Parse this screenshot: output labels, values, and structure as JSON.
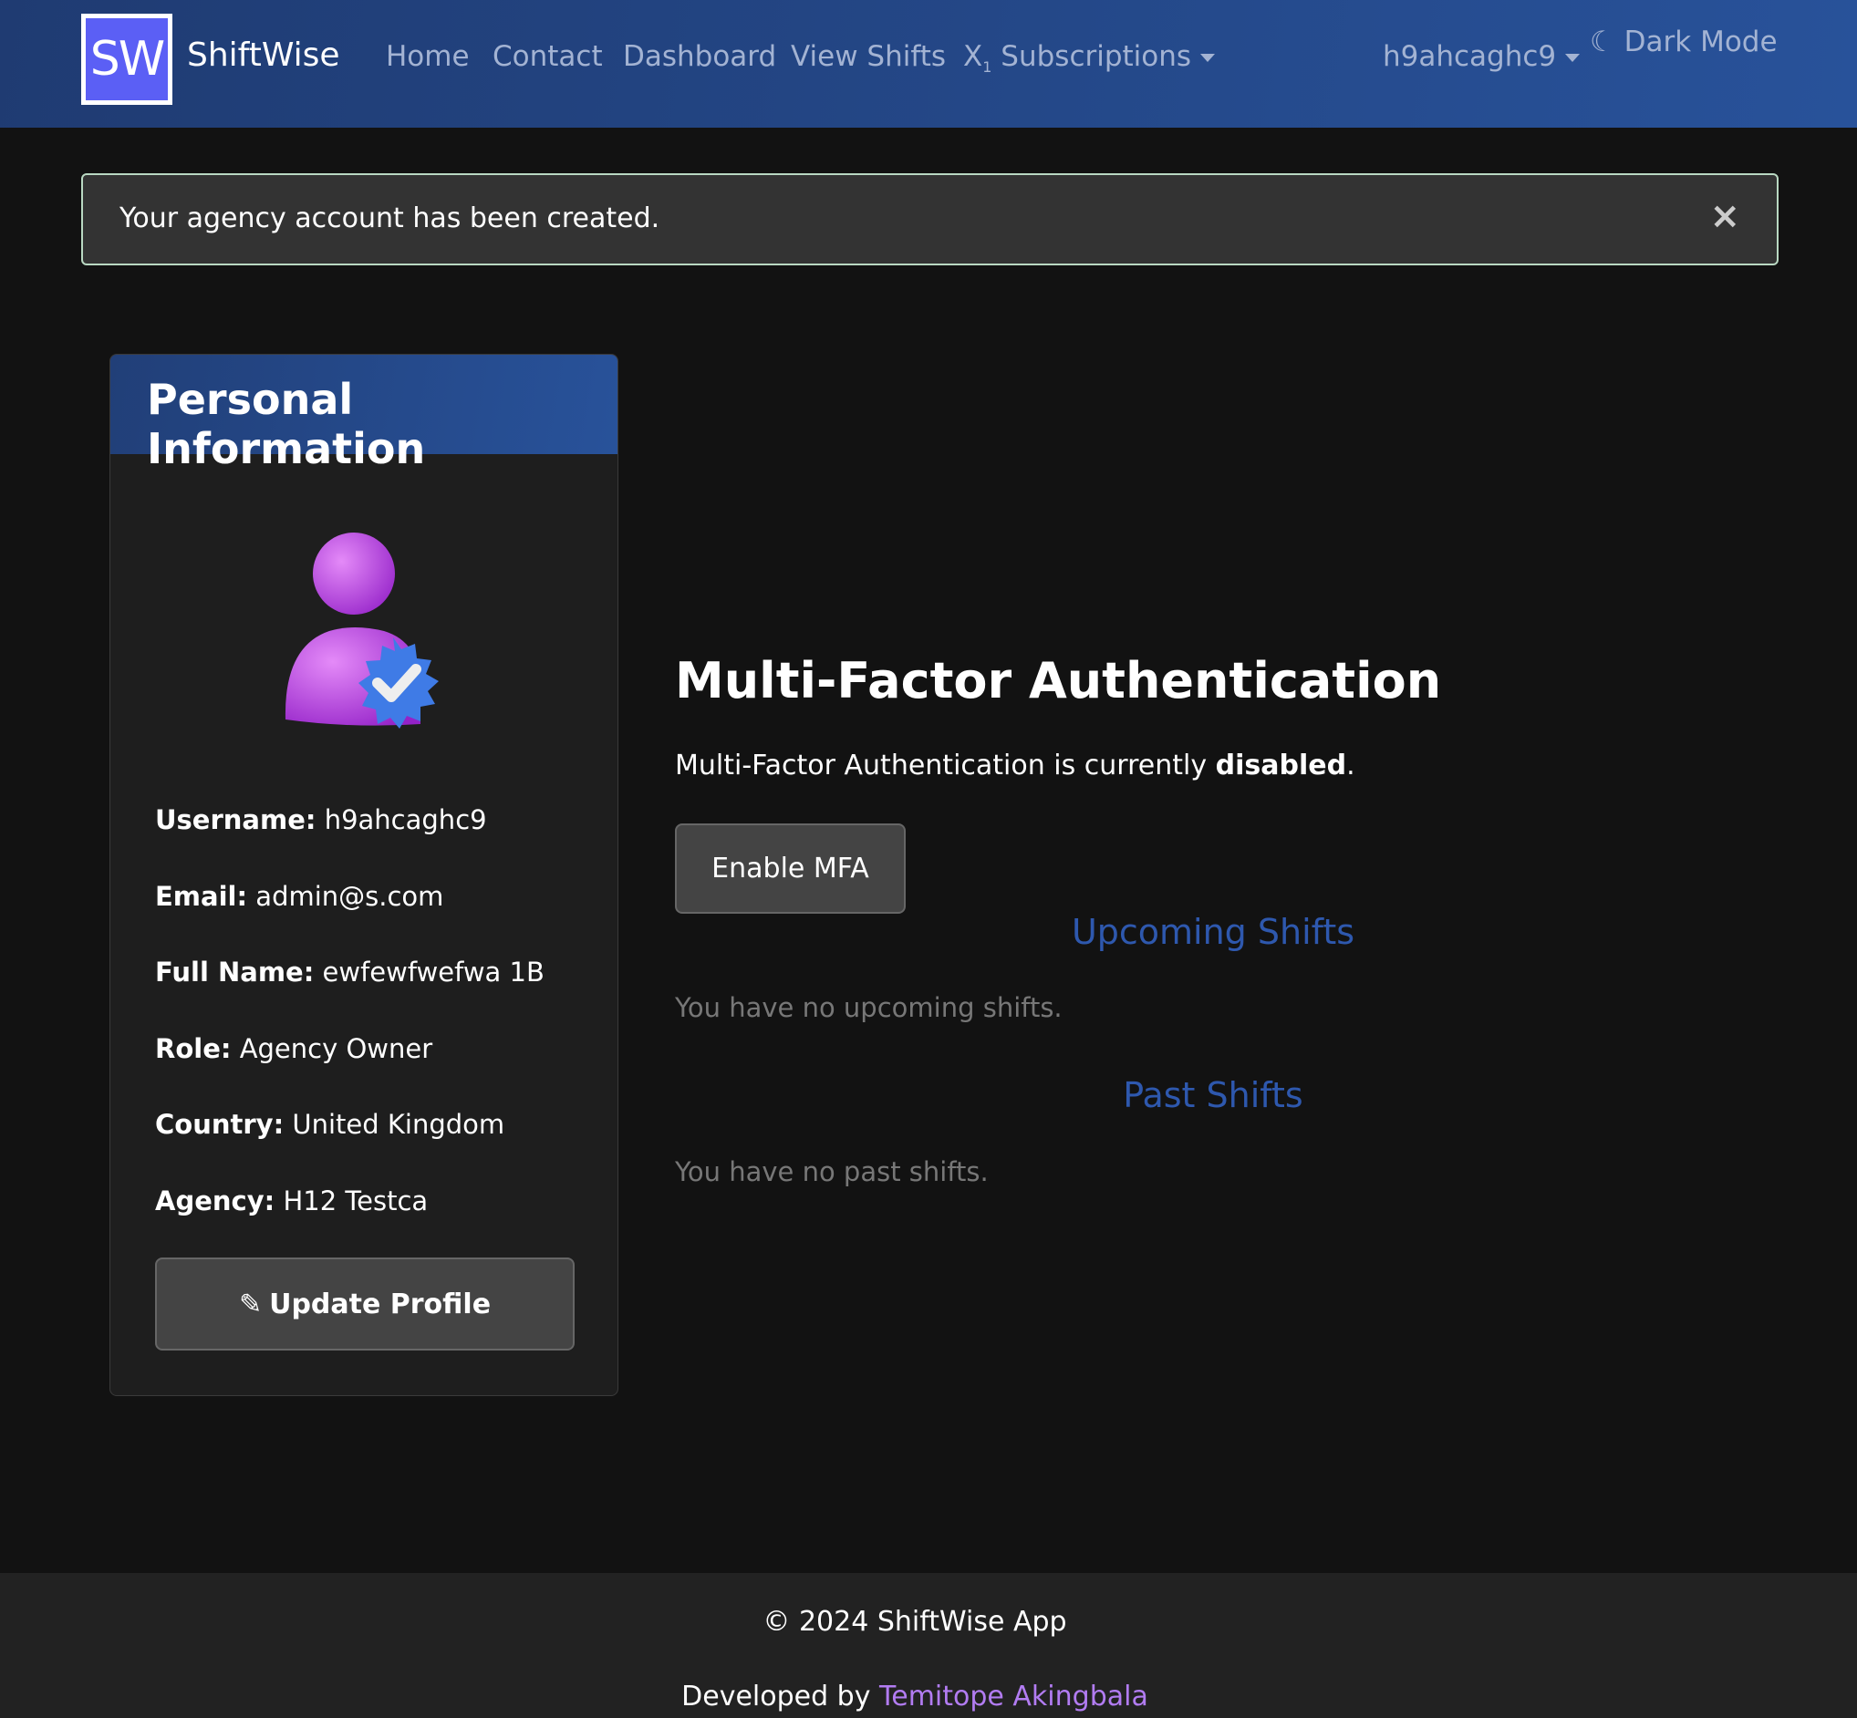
{
  "header": {
    "logo": "SW",
    "brand": "ShiftWise",
    "nav": [
      "Home",
      "Contact",
      "Dashboard",
      "View Shifts"
    ],
    "subscriptions": "Subscriptions",
    "subscriptions_icon": "subscript-icon",
    "user": "h9ahcaghc9",
    "dark_mode": "Dark Mode"
  },
  "alert": {
    "message": "Your agency account has been created.",
    "close": "×"
  },
  "profile": {
    "title": "Personal Information",
    "fields": [
      {
        "label": "Username:",
        "value": "h9ahcaghc9"
      },
      {
        "label": "Email:",
        "value": "admin@s.com"
      },
      {
        "label": "Full Name:",
        "value": "ewfewfwefwa 1B"
      },
      {
        "label": "Role:",
        "value": "Agency Owner"
      },
      {
        "label": "Country:",
        "value": "United Kingdom"
      },
      {
        "label": "Agency:",
        "value": "H12 Testca"
      }
    ],
    "update_button": "Update Profile"
  },
  "mfa": {
    "title": "Multi-Factor Authentication",
    "status_prefix": "Multi-Factor Authentication is currently ",
    "status": "disabled",
    "status_suffix": ".",
    "button": "Enable MFA"
  },
  "shifts": {
    "upcoming_title": "Upcoming Shifts",
    "upcoming_empty": "You have no upcoming shifts.",
    "past_title": "Past Shifts",
    "past_empty": "You have no past shifts."
  },
  "footer": {
    "copyright": "© 2024 ShiftWise App",
    "developed_by": "Developed by ",
    "author": "Temitope Akingbala"
  }
}
